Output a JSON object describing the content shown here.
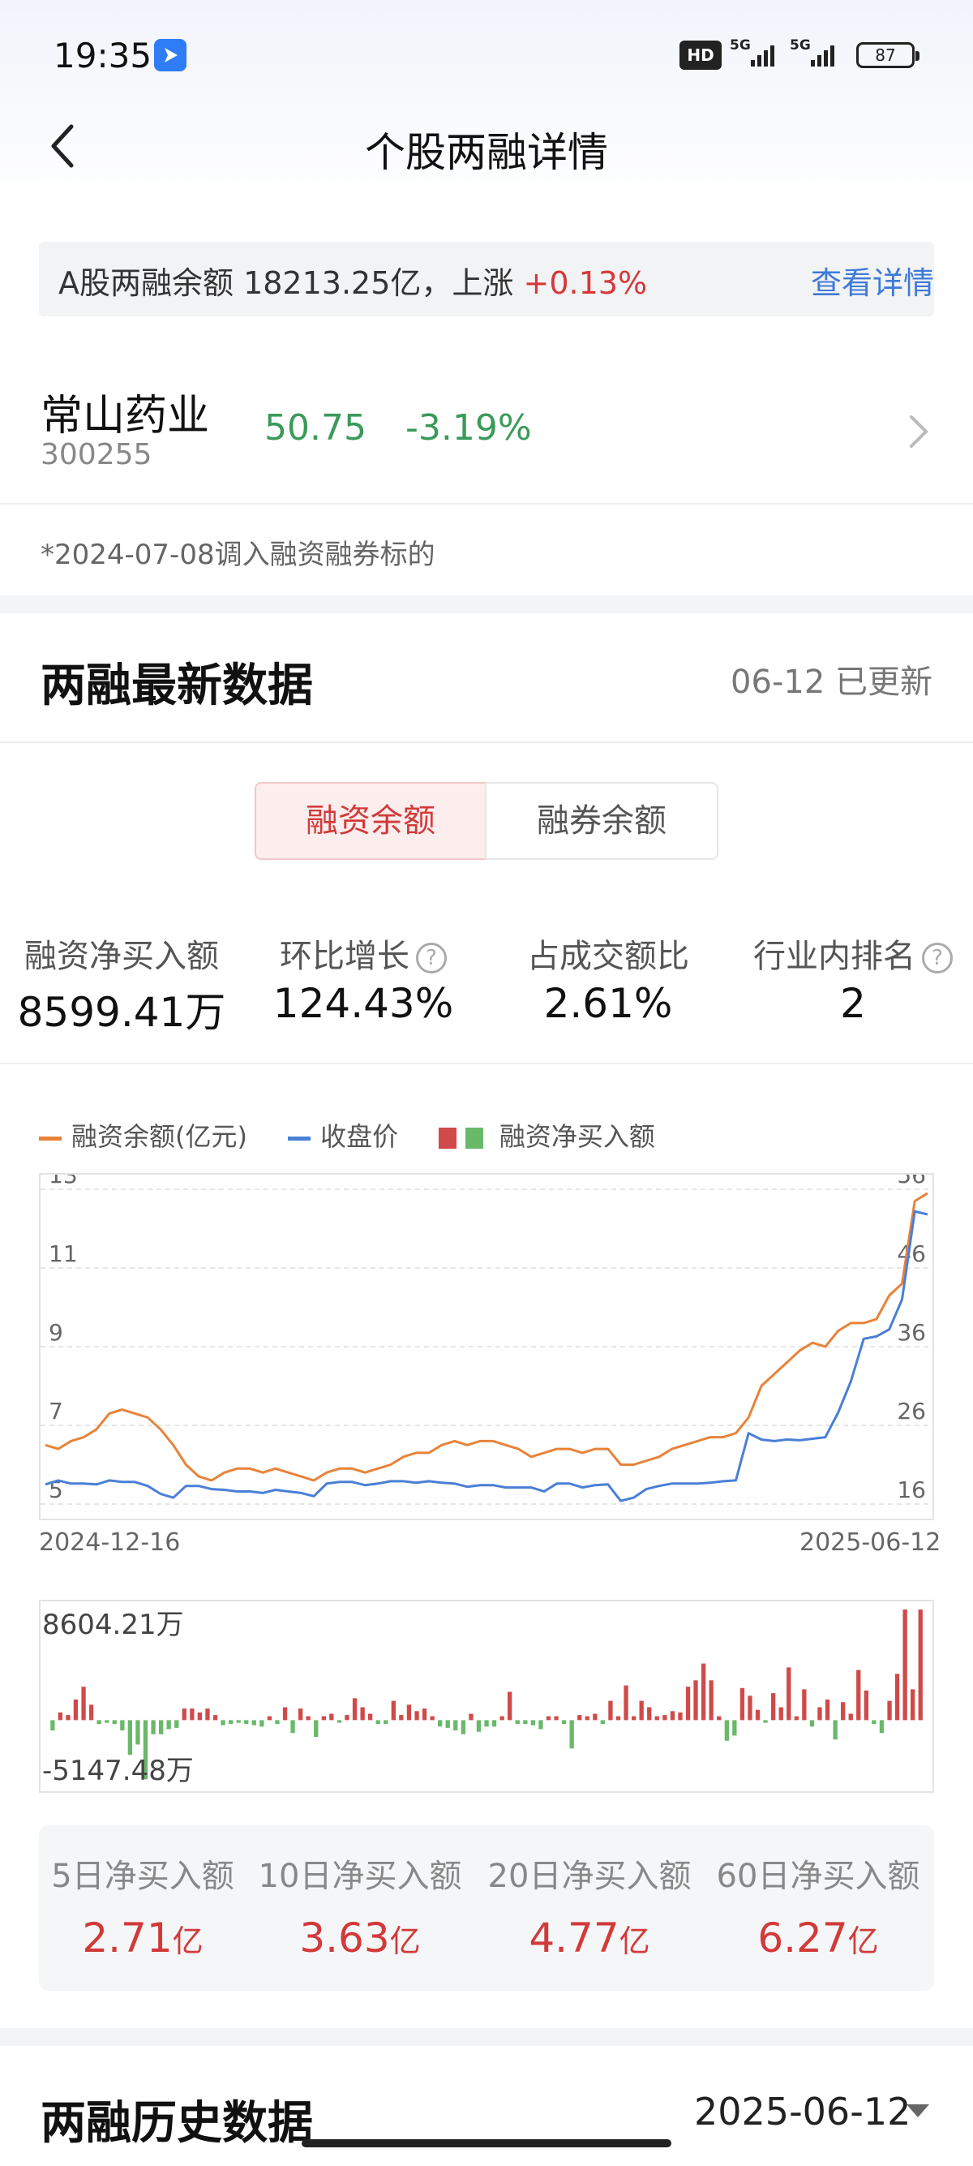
{
  "status_bar": {
    "time": "19:35",
    "hd_label": "HD",
    "signal_1": "5G",
    "signal_2": "5G",
    "battery": "87"
  },
  "header": {
    "title": "个股两融详情",
    "back_icon": "chevron-left-icon"
  },
  "banner": {
    "text": "A股两融余额 18213.25亿，上涨",
    "change": "+0.13%",
    "link": "查看详情"
  },
  "stock": {
    "name": "常山药业",
    "code": "300255",
    "price": "50.75",
    "change": "-3.19%"
  },
  "note": "*2024-07-08调入融资融券标的",
  "latest": {
    "title": "两融最新数据",
    "updated": "06-12 已更新",
    "tabs": [
      {
        "label": "融资余额",
        "active": true
      },
      {
        "label": "融券余额",
        "active": false
      }
    ],
    "metrics": [
      {
        "label": "融资净买入额",
        "value": "8599.41万"
      },
      {
        "label": "环比增长",
        "value": "124.43%",
        "help": "?"
      },
      {
        "label": "占成交额比",
        "value": "2.61%"
      },
      {
        "label": "行业内排名",
        "value": "2",
        "help": "?"
      }
    ]
  },
  "legend": {
    "balance": "融资余额(亿元)",
    "close": "收盘价",
    "net_buy": "融资净买入额"
  },
  "colors": {
    "up": "#d23a3a",
    "down": "#3a9a5a",
    "balance_line": "#e8833a",
    "price_line": "#4a7fd6",
    "bar_pos": "#d04a4a",
    "bar_neg": "#6ab86a"
  },
  "chart_data": [
    {
      "type": "line",
      "x_start": "2024-12-16",
      "x_end": "2025-06-12",
      "left_axis_ticks": [
        "13",
        "11",
        "9",
        "7",
        "5"
      ],
      "right_axis_ticks": [
        "56",
        "46",
        "36",
        "26",
        "16"
      ],
      "ylim_left": [
        5,
        13
      ],
      "ylim_right": [
        16,
        56
      ],
      "grid": true,
      "series": [
        {
          "name": "融资余额(亿元)",
          "axis": "left",
          "values": [
            6.5,
            6.4,
            6.6,
            6.7,
            6.9,
            7.3,
            7.4,
            7.3,
            7.2,
            6.9,
            6.5,
            6.0,
            5.7,
            5.6,
            5.8,
            5.9,
            5.9,
            5.8,
            5.9,
            5.8,
            5.7,
            5.6,
            5.8,
            5.9,
            5.9,
            5.8,
            5.9,
            6.0,
            6.2,
            6.3,
            6.3,
            6.5,
            6.6,
            6.5,
            6.6,
            6.6,
            6.5,
            6.4,
            6.2,
            6.3,
            6.4,
            6.4,
            6.3,
            6.4,
            6.4,
            6.0,
            6.0,
            6.1,
            6.2,
            6.4,
            6.5,
            6.6,
            6.7,
            6.7,
            6.8,
            7.2,
            8.0,
            8.3,
            8.6,
            8.9,
            9.1,
            9.0,
            9.4,
            9.6,
            9.6,
            9.7,
            10.3,
            10.6,
            12.7,
            12.9
          ]
        },
        {
          "name": "收盘价",
          "axis": "right",
          "values": [
            18.5,
            19.0,
            18.6,
            18.6,
            18.5,
            19.0,
            18.8,
            18.8,
            18.3,
            17.3,
            16.8,
            18.3,
            18.3,
            17.9,
            17.8,
            17.6,
            17.6,
            17.4,
            17.8,
            17.6,
            17.4,
            17.0,
            18.6,
            18.8,
            18.8,
            18.4,
            18.6,
            18.9,
            18.9,
            18.7,
            18.9,
            18.7,
            18.6,
            18.2,
            18.4,
            18.4,
            18.1,
            18.1,
            18.1,
            17.6,
            18.6,
            18.6,
            18.1,
            18.4,
            18.5,
            16.4,
            16.8,
            17.9,
            18.3,
            18.6,
            18.6,
            18.6,
            18.7,
            18.9,
            19.0,
            25.0,
            24.2,
            24.0,
            24.2,
            24.1,
            24.3,
            24.5,
            27.6,
            31.6,
            37.0,
            37.3,
            38.2,
            42.0,
            53.2,
            52.8
          ]
        }
      ]
    },
    {
      "type": "bar",
      "title": "融资净买入额",
      "max_label": "8604.21万",
      "min_label": "-5147.48万",
      "ylim": [
        -5147.48,
        8604.21
      ],
      "values": [
        -800,
        600,
        400,
        1600,
        2600,
        1200,
        -300,
        -200,
        -300,
        -800,
        -2700,
        -1900,
        -4600,
        -1100,
        -1100,
        -700,
        -600,
        900,
        900,
        600,
        900,
        400,
        -400,
        -300,
        -200,
        -300,
        -400,
        -500,
        300,
        -300,
        1000,
        -1000,
        900,
        300,
        -1300,
        300,
        500,
        -200,
        400,
        1700,
        1000,
        500,
        -300,
        -300,
        1500,
        400,
        1200,
        700,
        900,
        300,
        -500,
        -600,
        -800,
        -1100,
        500,
        -900,
        -500,
        -500,
        300,
        2200,
        -300,
        -300,
        -400,
        -700,
        300,
        300,
        -300,
        -2200,
        400,
        300,
        500,
        -300,
        1500,
        300,
        2700,
        300,
        1500,
        1000,
        300,
        400,
        700,
        600,
        2600,
        3100,
        4400,
        3100,
        300,
        -1600,
        -1200,
        2500,
        1900,
        800,
        -200,
        2100,
        1000,
        4100,
        300,
        2400,
        -500,
        1000,
        1600,
        -1500,
        1400,
        500,
        3900,
        2300,
        -300,
        -1000,
        1500,
        3600,
        8604.21,
        2400,
        8599.41
      ]
    }
  ],
  "stats": [
    {
      "label": "5日净买入额",
      "value": "2.71",
      "unit": "亿"
    },
    {
      "label": "10日净买入额",
      "value": "3.63",
      "unit": "亿"
    },
    {
      "label": "20日净买入额",
      "value": "4.77",
      "unit": "亿"
    },
    {
      "label": "60日净买入额",
      "value": "6.27",
      "unit": "亿"
    }
  ],
  "history": {
    "title": "两融历史数据",
    "date": "2025-06-12",
    "dropdown_icon": "triangle-down-icon"
  }
}
